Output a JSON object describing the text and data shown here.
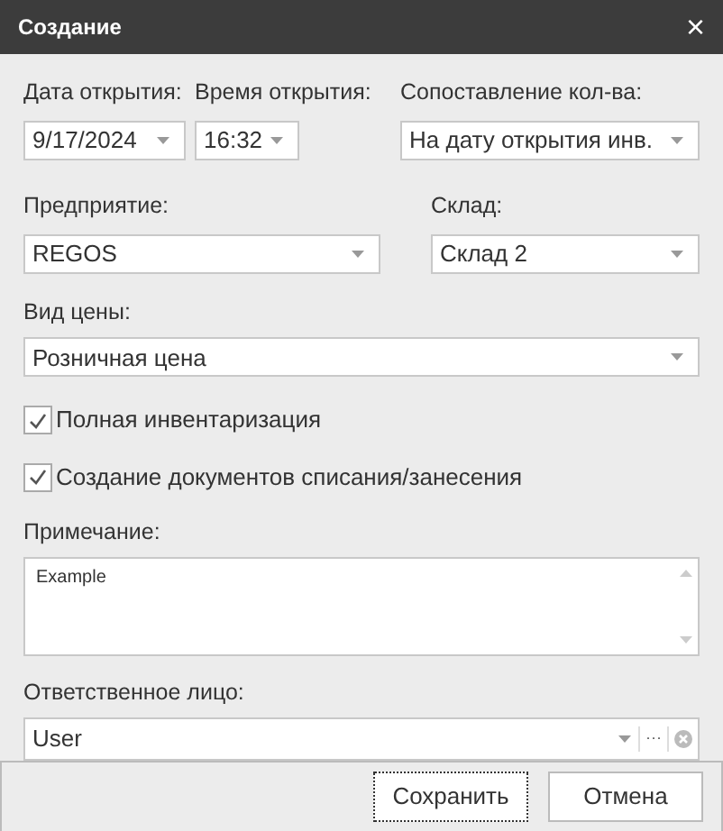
{
  "window": {
    "title": "Создание",
    "close": "×"
  },
  "fields": [
    {
      "label": "Дата открытия:",
      "value": "9/17/2024"
    },
    {
      "label": "Время открытия:",
      "value": "16:32"
    },
    {
      "label": "Сопоставление кол-ва:",
      "value": "На дату открытия инв."
    },
    {
      "label": "Предприятие:",
      "value": "REGOS"
    },
    {
      "label": "Склад:",
      "value": "Склад 2"
    },
    {
      "label": "Вид цены:",
      "value": "Розничная цена"
    }
  ],
  "checkboxes": [
    {
      "label": "Полная инвентаризация",
      "checked": true
    },
    {
      "label": "Создание документов списания/занесения",
      "checked": true
    }
  ],
  "note": {
    "label": "Примечание:",
    "value": "Example"
  },
  "responsible": {
    "label": "Ответственное лицо:",
    "value": "User",
    "more": "···"
  },
  "buttons": [
    {
      "label": "Сохранить",
      "focused": true
    },
    {
      "label": "Отмена",
      "focused": false
    }
  ]
}
